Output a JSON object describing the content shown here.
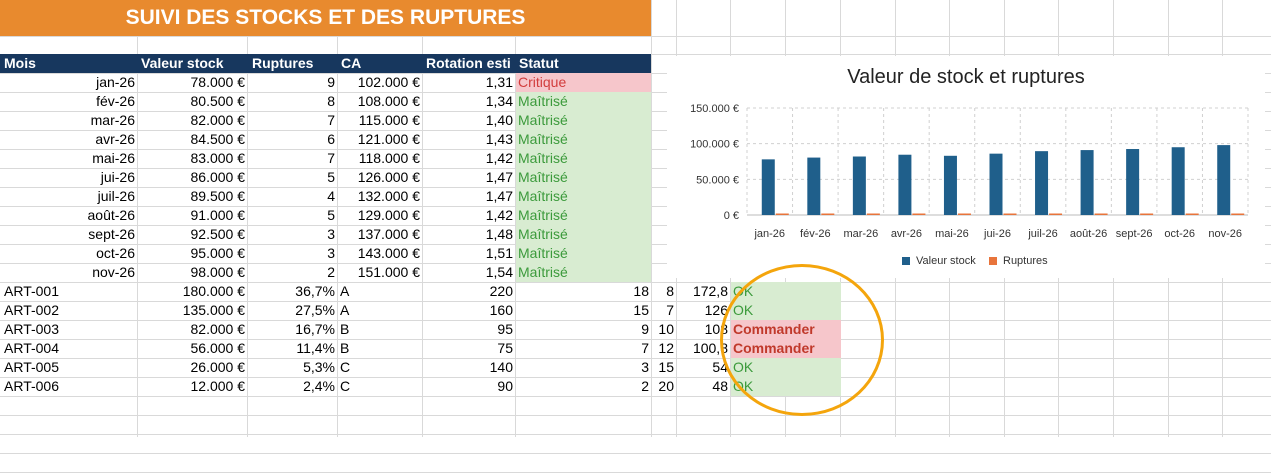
{
  "sheet_title": "SUIVI DES STOCKS ET DES RUPTURES",
  "headers": [
    "Mois",
    "Valeur stock",
    "Ruptures",
    "CA",
    "Rotation esti",
    "Statut"
  ],
  "monthly_rows": [
    {
      "mois": "jan-26",
      "valeur": "78.000 €",
      "ruptures": "9",
      "ca": "102.000 €",
      "rotation": "1,31",
      "statut": "Critique",
      "kind": "crit"
    },
    {
      "mois": "fév-26",
      "valeur": "80.500 €",
      "ruptures": "8",
      "ca": "108.000 €",
      "rotation": "1,34",
      "statut": "Maîtrisé",
      "kind": "ok"
    },
    {
      "mois": "mar-26",
      "valeur": "82.000 €",
      "ruptures": "7",
      "ca": "115.000 €",
      "rotation": "1,40",
      "statut": "Maîtrisé",
      "kind": "ok"
    },
    {
      "mois": "avr-26",
      "valeur": "84.500 €",
      "ruptures": "6",
      "ca": "121.000 €",
      "rotation": "1,43",
      "statut": "Maîtrisé",
      "kind": "ok"
    },
    {
      "mois": "mai-26",
      "valeur": "83.000 €",
      "ruptures": "7",
      "ca": "118.000 €",
      "rotation": "1,42",
      "statut": "Maîtrisé",
      "kind": "ok"
    },
    {
      "mois": "jui-26",
      "valeur": "86.000 €",
      "ruptures": "5",
      "ca": "126.000 €",
      "rotation": "1,47",
      "statut": "Maîtrisé",
      "kind": "ok"
    },
    {
      "mois": "juil-26",
      "valeur": "89.500 €",
      "ruptures": "4",
      "ca": "132.000 €",
      "rotation": "1,47",
      "statut": "Maîtrisé",
      "kind": "ok"
    },
    {
      "mois": "août-26",
      "valeur": "91.000 €",
      "ruptures": "5",
      "ca": "129.000 €",
      "rotation": "1,42",
      "statut": "Maîtrisé",
      "kind": "ok"
    },
    {
      "mois": "sept-26",
      "valeur": "92.500 €",
      "ruptures": "3",
      "ca": "137.000 €",
      "rotation": "1,48",
      "statut": "Maîtrisé",
      "kind": "ok"
    },
    {
      "mois": "oct-26",
      "valeur": "95.000 €",
      "ruptures": "3",
      "ca": "143.000 €",
      "rotation": "1,51",
      "statut": "Maîtrisé",
      "kind": "ok"
    },
    {
      "mois": "nov-26",
      "valeur": "98.000 €",
      "ruptures": "2",
      "ca": "151.000 €",
      "rotation": "1,54",
      "statut": "Maîtrisé",
      "kind": "ok"
    }
  ],
  "article_rows": [
    {
      "ref": "ART-001",
      "valeur": "180.000 €",
      "pct": "36,7%",
      "cls": "A",
      "qty": "220",
      "c1": "18",
      "c2": "8",
      "c3": "172,8",
      "statut": "OK",
      "kind": "ok"
    },
    {
      "ref": "ART-002",
      "valeur": "135.000 €",
      "pct": "27,5%",
      "cls": "A",
      "qty": "160",
      "c1": "15",
      "c2": "7",
      "c3": "126",
      "statut": "OK",
      "kind": "ok"
    },
    {
      "ref": "ART-003",
      "valeur": "82.000 €",
      "pct": "16,7%",
      "cls": "B",
      "qty": "95",
      "c1": "9",
      "c2": "10",
      "c3": "108",
      "statut": "Commander",
      "kind": "cmd"
    },
    {
      "ref": "ART-004",
      "valeur": "56.000 €",
      "pct": "11,4%",
      "cls": "B",
      "qty": "75",
      "c1": "7",
      "c2": "12",
      "c3": "100,8",
      "statut": "Commander",
      "kind": "cmd"
    },
    {
      "ref": "ART-005",
      "valeur": "26.000 €",
      "pct": "5,3%",
      "cls": "C",
      "qty": "140",
      "c1": "3",
      "c2": "15",
      "c3": "54",
      "statut": "OK",
      "kind": "ok"
    },
    {
      "ref": "ART-006",
      "valeur": "12.000 €",
      "pct": "2,4%",
      "cls": "C",
      "qty": "90",
      "c1": "2",
      "c2": "20",
      "c3": "48",
      "statut": "OK",
      "kind": "ok"
    }
  ],
  "chart_data": {
    "type": "bar",
    "title": "Valeur de stock et ruptures",
    "categories": [
      "jan-26",
      "fév-26",
      "mar-26",
      "avr-26",
      "mai-26",
      "jui-26",
      "juil-26",
      "août-26",
      "sept-26",
      "oct-26",
      "nov-26"
    ],
    "series": [
      {
        "name": "Valeur stock",
        "values": [
          78000,
          80500,
          82000,
          84500,
          83000,
          86000,
          89500,
          91000,
          92500,
          95000,
          98000
        ],
        "color": "#1f5f8b"
      },
      {
        "name": "Ruptures",
        "values": [
          9,
          8,
          7,
          6,
          7,
          5,
          4,
          5,
          3,
          3,
          2
        ],
        "color": "#e8743b"
      }
    ],
    "ylim": [
      0,
      150000
    ],
    "yticks": [
      "0 €",
      "50.000 €",
      "100.000 €",
      "150.000 €"
    ],
    "grid": true,
    "legend": "bottom"
  },
  "colors": {
    "title_bg": "#e88a2e",
    "header_bg": "#17375e",
    "ok_bg": "#d8ecd1",
    "crit_bg": "#f6c6cb",
    "highlight": "#f4a50c"
  }
}
